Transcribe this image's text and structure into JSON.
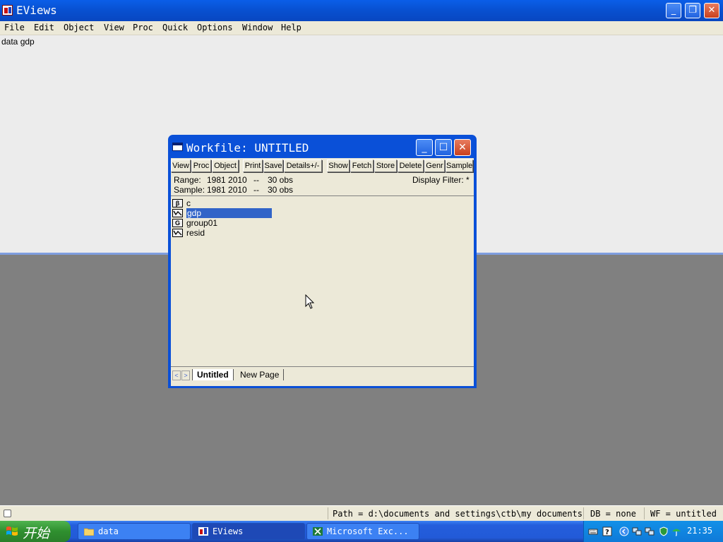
{
  "app": {
    "title": "EViews",
    "window_buttons": {
      "minimize": "_",
      "restore": "❐",
      "close": "✕"
    }
  },
  "menu": [
    "File",
    "Edit",
    "Object",
    "View",
    "Proc",
    "Quick",
    "Options",
    "Window",
    "Help"
  ],
  "command": {
    "text": "data gdp"
  },
  "workfile": {
    "title": "Workfile: UNTITLED",
    "toolbar": [
      "View",
      "Proc",
      "Object",
      "Print",
      "Save",
      "Details+/-",
      "Show",
      "Fetch",
      "Store",
      "Delete",
      "Genr",
      "Sample"
    ],
    "range_label": "Range:",
    "range_value": "1981 2010",
    "range_sep": "--",
    "range_obs": "30 obs",
    "sample_label": "Sample:",
    "sample_value": "1981 2010",
    "sample_sep": "--",
    "sample_obs": "30 obs",
    "display_filter": "Display Filter: *",
    "objects": [
      {
        "name": "c",
        "icon": "coef-icon",
        "glyph": "β",
        "selected": false
      },
      {
        "name": "gdp",
        "icon": "series-icon",
        "glyph": "",
        "selected": true
      },
      {
        "name": "group01",
        "icon": "group-icon",
        "glyph": "G",
        "selected": false
      },
      {
        "name": "resid",
        "icon": "series-icon",
        "glyph": "",
        "selected": false
      }
    ],
    "tabs": [
      "Untitled",
      "New Page"
    ],
    "tab_prev": "<",
    "tab_next": ">"
  },
  "status": {
    "path": "Path = d:\\documents and settings\\ctb\\my documents",
    "db": "DB = none",
    "wf": "WF = untitled"
  },
  "taskbar": {
    "start": "开始",
    "tasks": [
      "data",
      "EViews",
      "Microsoft Exc..."
    ],
    "time": "21:35"
  },
  "colors": {
    "titlebar": "#0a5ee8",
    "selection": "#3164c8",
    "start": "#2f8f2f"
  }
}
